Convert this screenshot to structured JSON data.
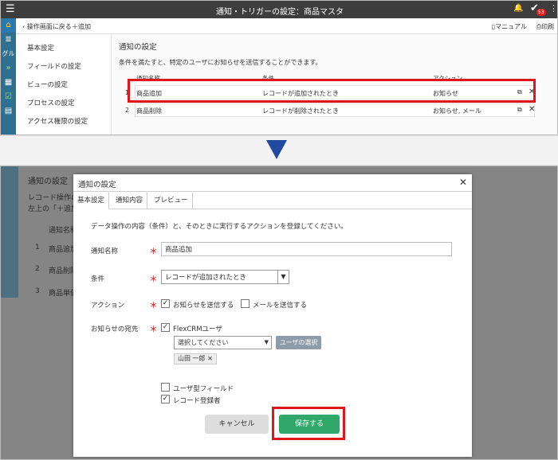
{
  "app": {
    "title": "通知・トリガーの設定：商品マスタ",
    "notification_badge": "53"
  },
  "toolbar": {
    "back_label": "操作画面に戻る",
    "add_label": "追加",
    "manual_label": "マニュアル",
    "print_label": "印刷"
  },
  "leftbar": {
    "group_label": "グル"
  },
  "sidemenu": {
    "items": [
      "基本設定",
      "フィールドの設定",
      "ビューの設定",
      "プロセスの設定",
      "アクセス権限の設定"
    ]
  },
  "panel": {
    "heading": "通知の設定",
    "description": "条件を満たすと、特定のユーザにお知らせを送信することができます。",
    "columns": [
      "通知名称",
      "条件",
      "アクション"
    ],
    "rows": [
      {
        "num": "1",
        "name": "商品追加",
        "condition": "レコードが追加されたとき",
        "action": "お知らせ"
      },
      {
        "num": "2",
        "name": "商品削除",
        "condition": "レコードが削除されたとき",
        "action": "お知らせ, メール"
      }
    ]
  },
  "background": {
    "heading": "通知の設定",
    "line1": "レコード操作の",
    "line2": "左上の「＋追加",
    "col": "通知名称",
    "rows": [
      {
        "num": "1",
        "name": "商品追加"
      },
      {
        "num": "2",
        "name": "商品削除"
      },
      {
        "num": "3",
        "name": "商品単価"
      }
    ]
  },
  "modal": {
    "title": "通知の設定",
    "tabs": [
      "基本設定",
      "通知内容",
      "プレビュー"
    ],
    "intro": "データ操作の内容（条件）と、そのときに実行するアクションを登録してください。",
    "name_label": "通知名称",
    "name_value": "商品追加",
    "condition_label": "条件",
    "condition_value": "レコードが追加されたとき",
    "action_label": "アクション",
    "action_notice": "お知らせを送信する",
    "action_mail": "メールを送信する",
    "dest_label": "お知らせの宛先",
    "dest_user": "FlexCRMユーザ",
    "user_select_placeholder": "選択してください",
    "user_select_button": "ユーザの選択",
    "selected_user": "山田 一郎",
    "user_field": "ユーザ型フィールド",
    "record_creator": "レコード登録者",
    "cancel_label": "キャンセル",
    "save_label": "保存する"
  }
}
